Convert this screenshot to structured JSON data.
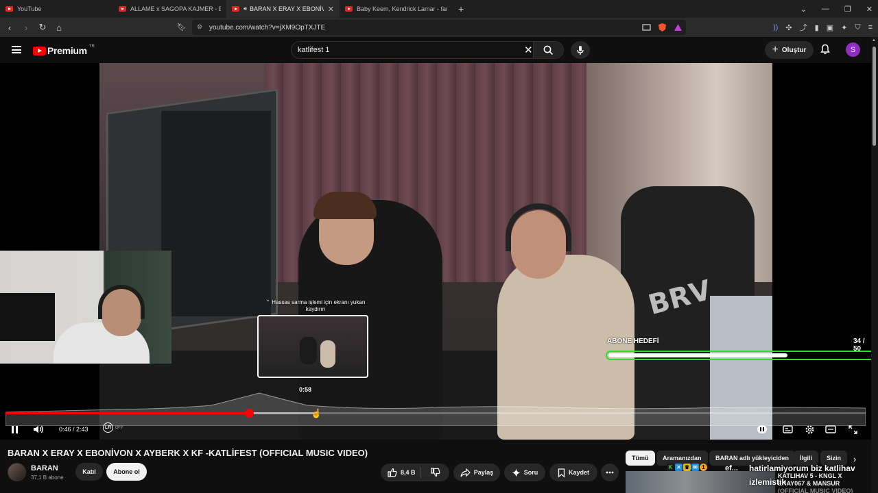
{
  "browser": {
    "tabs": [
      {
        "title": "YouTube",
        "active": false
      },
      {
        "title": "ALLAME x SAGOPA KAJMER - BİR ŞA",
        "active": false
      },
      {
        "title": "BARAN X ERAY X EBONİVON",
        "active": true
      },
      {
        "title": "Baby Keem, Kendrick Lamar - family",
        "active": false
      }
    ],
    "url": "youtube.com/watch?v=jXM9OpTXJTE"
  },
  "header": {
    "logo_text": "Premium",
    "logo_country": "TR",
    "search_value": "katlifest 1",
    "create_label": "Oluştur",
    "avatar_letter": "S"
  },
  "player": {
    "swipe_hint": "Hassas sarma işlemi için ekranı yukarı kaydırın",
    "preview_time": "0:58",
    "goal_label": "ABONE HEDEFİ",
    "goal_count": "34 / 50",
    "goal_fraction": 0.68,
    "current_time": "0:46",
    "duration": "2:43",
    "time_display": "0:46 / 2:43",
    "played_fraction": 0.283,
    "buffered_fraction": 0.36,
    "lr_label": "LR",
    "lr_state": "OFF",
    "accent": "#ff0000"
  },
  "video": {
    "title": "BARAN X ERAY X EBONİVON X AYBERK X KF -KATLİFEST (OFFICIAL MUSIC VIDEO)",
    "channel_name": "BARAN",
    "subscribers": "37,1 B abone",
    "join_label": "Katıl",
    "subscribe_label": "Abone ol",
    "likes": "8,4 B",
    "share_label": "Paylaş",
    "ask_label": "Soru",
    "save_label": "Kaydet"
  },
  "chips": [
    "Tümü",
    "Aramanızdan",
    "BARAN adlı yükleyiciden",
    "İlgili",
    "Sizin"
  ],
  "recommendation": {
    "overlay_line1": "hatirlamiyorum biz katlihav",
    "overlay_line2": "izlemistik",
    "ef_text": "ef...",
    "title_line1": "KATLIHAV 5 - KNGL X",
    "title_line2": "ERAY067 & MANSUR",
    "title_line3": "(OFFICIAL MUSIC VIDEO)"
  }
}
